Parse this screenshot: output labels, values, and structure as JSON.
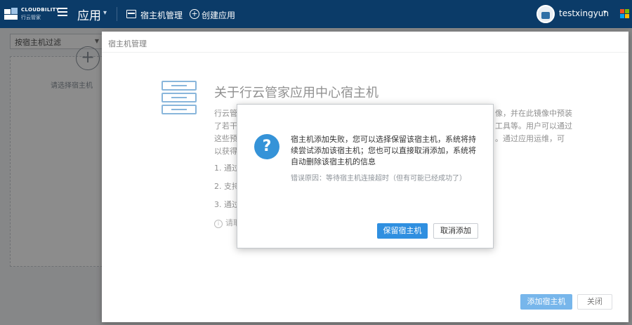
{
  "topbar": {
    "logo_name": "CLOUDBILITY",
    "logo_sub": "行云管家",
    "app_title": "应用",
    "nav_host": "宿主机管理",
    "nav_create": "创建应用",
    "username": "testxingyun",
    "colors": {
      "bar": "#0b3b68",
      "ms_red": "#f25022",
      "ms_green": "#7fba00",
      "ms_blue": "#00a4ef",
      "ms_yellow": "#ffb900"
    }
  },
  "background_page": {
    "filter_placeholder": "按宿主机过滤",
    "empty_hint": "请选择宿主机"
  },
  "host_modal": {
    "title": "宿主机管理",
    "about_title": "关于行云管家应用中心宿主机",
    "about_text_left": "行云管\n了若干\n这些预\n以获得",
    "about_text_right": "像，并在此镜像中预装\n工具等。用户可以通过\n。通过应用运维，可",
    "list_items": [
      "1. 通过",
      "2. 支持",
      "3. 通过"
    ],
    "note": "请耶",
    "add_button": "添加宿主机",
    "close_button": "关闭"
  },
  "alert": {
    "message": "宿主机添加失败，您可以选择保留该宿主机，系统将持续尝试添加该宿主机；您也可以直接取消添加，系统将自动删除该宿主机的信息",
    "reason": "错误原因：等待宿主机连接超时（但有可能已经成功了）",
    "keep_button": "保留宿主机",
    "cancel_button": "取消添加",
    "icon": "question-icon",
    "accent": "#3593d8"
  }
}
